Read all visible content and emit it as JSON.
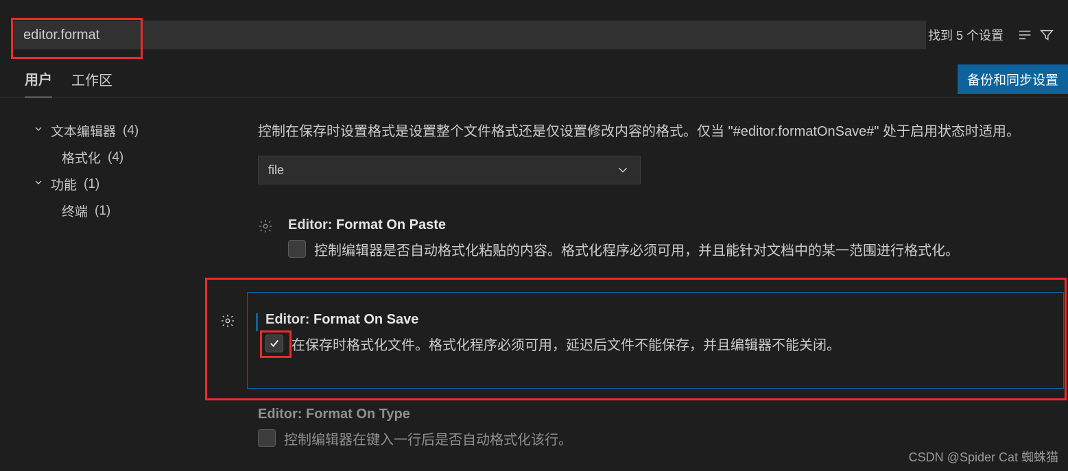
{
  "search": {
    "value": "editor.format"
  },
  "status": {
    "found_text": "找到 5 个设置"
  },
  "tabs": {
    "user": "用户",
    "workspace": "工作区"
  },
  "backup_button": "备份和同步设置",
  "sidebar": {
    "text_editor": {
      "label": "文本编辑器",
      "count": "(4)"
    },
    "formatting": {
      "label": "格式化",
      "count": "(4)"
    },
    "features": {
      "label": "功能",
      "count": "(1)"
    },
    "terminal": {
      "label": "终端",
      "count": "(1)"
    }
  },
  "settings": {
    "mode": {
      "desc": "控制在保存时设置格式是设置整个文件格式还是仅设置修改内容的格式。仅当 \"#editor.formatOnSave#\" 处于启用状态时适用。",
      "value": "file"
    },
    "onPaste": {
      "prefix": "Editor: ",
      "name": "Format On Paste",
      "desc": "控制编辑器是否自动格式化粘贴的内容。格式化程序必须可用，并且能针对文档中的某一范围进行格式化。"
    },
    "onSave": {
      "prefix": "Editor: ",
      "name": "Format On Save",
      "desc": "在保存时格式化文件。格式化程序必须可用，延迟后文件不能保存，并且编辑器不能关闭。"
    },
    "onType": {
      "prefix": "Editor: ",
      "name": "Format On Type",
      "desc": "控制编辑器在键入一行后是否自动格式化该行。"
    }
  },
  "watermark": "CSDN @Spider Cat 蜘蛛猫"
}
